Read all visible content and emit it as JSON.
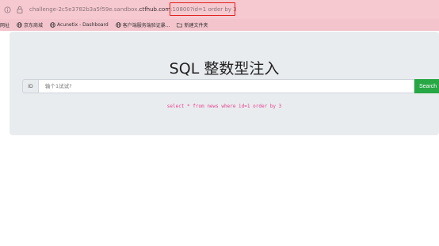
{
  "browser": {
    "url_prefix": "challenge-2c5e3782b3a5f59e.sandbox.",
    "url_host": "ctfhub.com",
    "url_port_path": ":10800",
    "url_query": "?id=1 order by 3"
  },
  "bookmarks": [
    {
      "label": "网址",
      "icon": "globe-icon"
    },
    {
      "label": "京东商城",
      "icon": "globe-icon"
    },
    {
      "label": "Acunetix - Dashboard",
      "icon": "globe-icon"
    },
    {
      "label": "客户端服务端验证暴...",
      "icon": "globe-icon"
    },
    {
      "label": "新建文件夹",
      "icon": "folder-icon"
    }
  ],
  "page": {
    "title": "SQL 整数型注入",
    "id_label": "ID",
    "search_placeholder": "输个1试试?",
    "search_button": "Search",
    "sql_query": "select * from news where id=1 order by 3"
  },
  "colors": {
    "address_bar": "#f6c9d0",
    "highlight_box": "#e0201e",
    "button": "#28a745",
    "sql_text": "#e83e8c"
  }
}
